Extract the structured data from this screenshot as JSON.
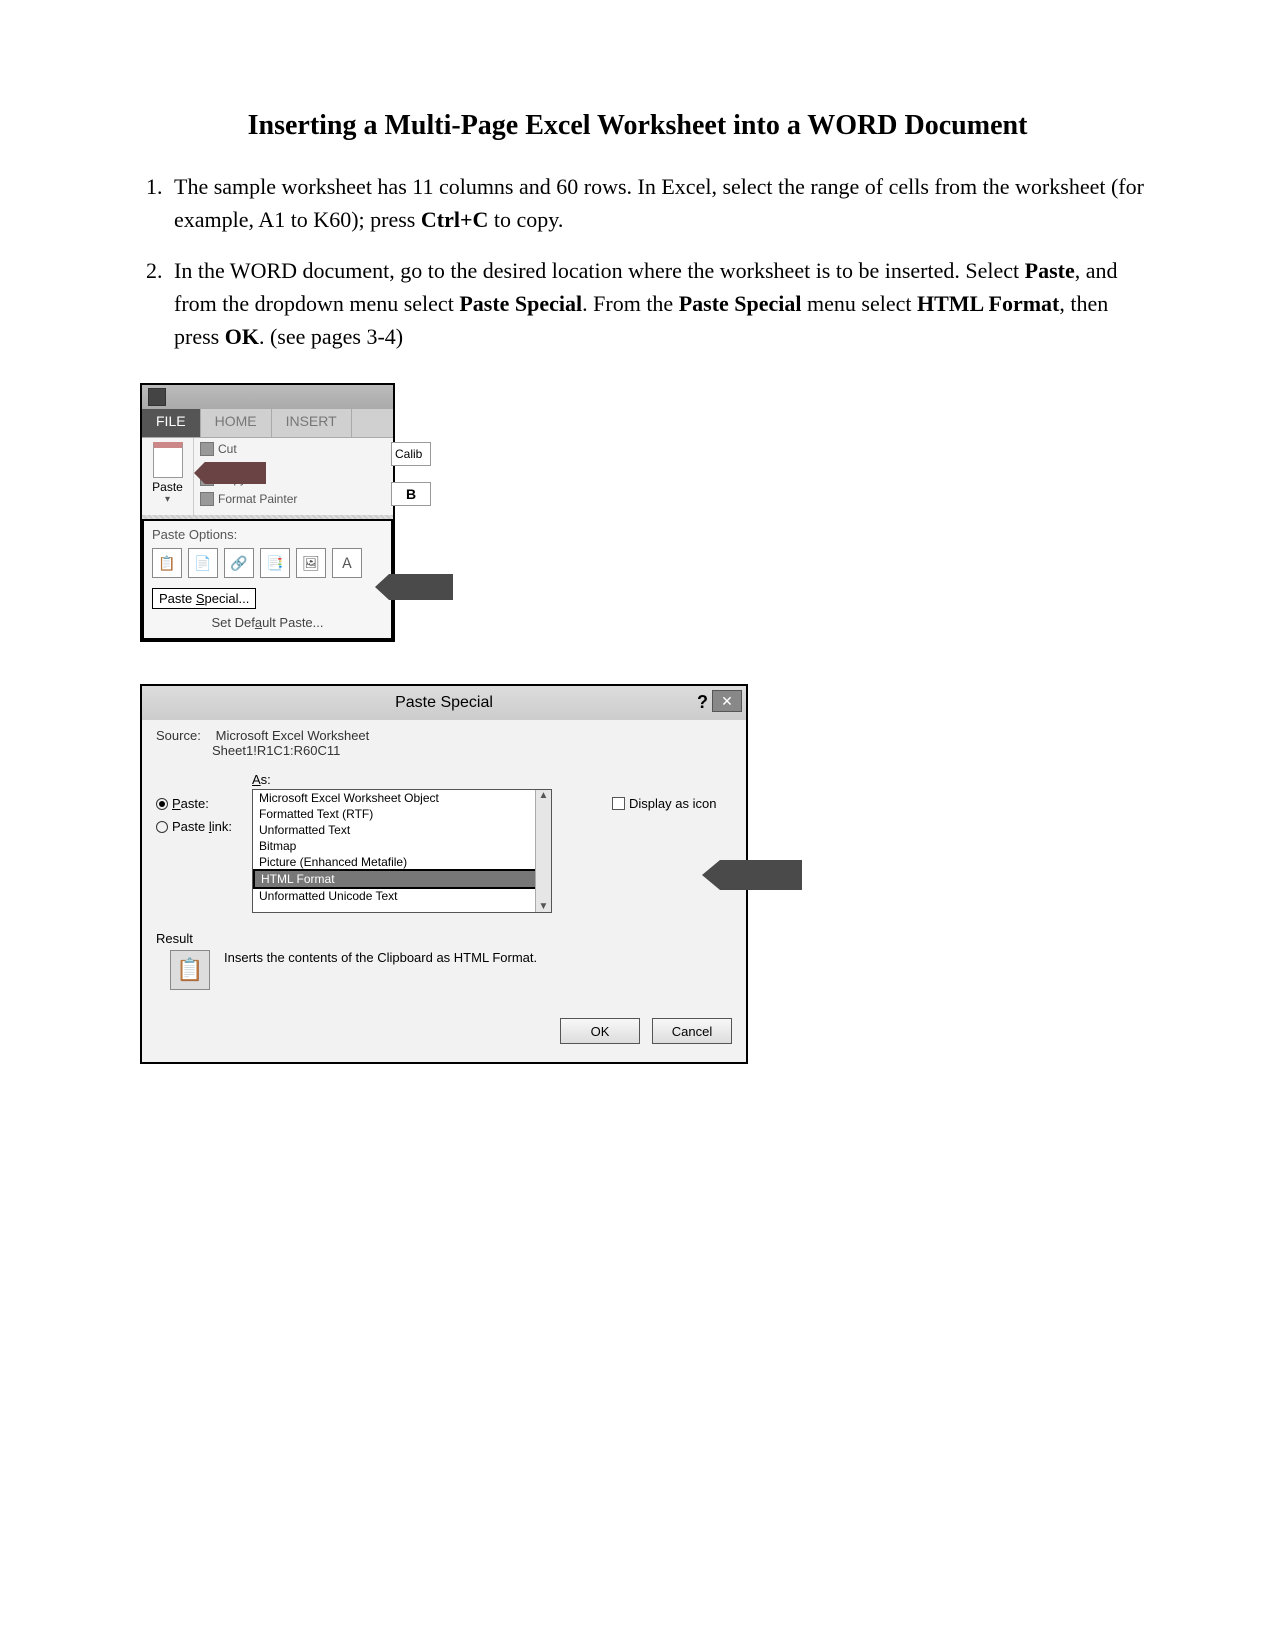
{
  "title": "Inserting a Multi-Page Excel Worksheet into a WORD Document",
  "steps": [
    {
      "pre": "The sample worksheet has 11 columns and 60 rows. In Excel, select the range of cells from the worksheet (for example, A1 to K60); press ",
      "b1": "Ctrl+C",
      "post": " to copy."
    },
    {
      "pre": "In the WORD document, go to the desired location where the worksheet is to be inserted. Select ",
      "b1": "Paste",
      "mid1": ", and from the dropdown menu select ",
      "b2": "Paste Special",
      "mid2": ". From the ",
      "b3": "Paste Special",
      "mid3": " menu select ",
      "b4": "HTML Format",
      "mid4": ", then press ",
      "b5": "OK",
      "post": ". (see pages 3-4)"
    }
  ],
  "ribbon": {
    "tabs": {
      "file": "FILE",
      "home": "HOME",
      "insert": "INSERT"
    },
    "paste": "Paste",
    "cut": "Cut",
    "copy": "Copy",
    "fmt_painter": "Format Painter",
    "font": "Calib",
    "bold": "B",
    "dropdown": {
      "heading": "Paste Options:",
      "paste_special": "Paste Special...",
      "set_default": "Set Default Paste...",
      "s_letter": "S",
      "a_letter": "a"
    }
  },
  "dialog": {
    "title": "Paste Special",
    "help": "?",
    "close": "✕",
    "source_label": "Source:",
    "source_line1": "Microsoft Excel Worksheet",
    "source_line2": "Sheet1!R1C1:R60C11",
    "as_label": "As:",
    "radio_paste": "Paste:",
    "radio_link": "Paste link:",
    "list": [
      "Microsoft Excel Worksheet Object",
      "Formatted Text (RTF)",
      "Unformatted Text",
      "Bitmap",
      "Picture (Enhanced Metafile)",
      "HTML Format",
      "Unformatted Unicode Text"
    ],
    "display_as_icon": "Display as icon",
    "result_label": "Result",
    "result_text": "Inserts the contents of the Clipboard as HTML Format.",
    "ok": "OK",
    "cancel": "Cancel",
    "p_letter": "P",
    "l_letter": "l",
    "a_letter": "A"
  }
}
